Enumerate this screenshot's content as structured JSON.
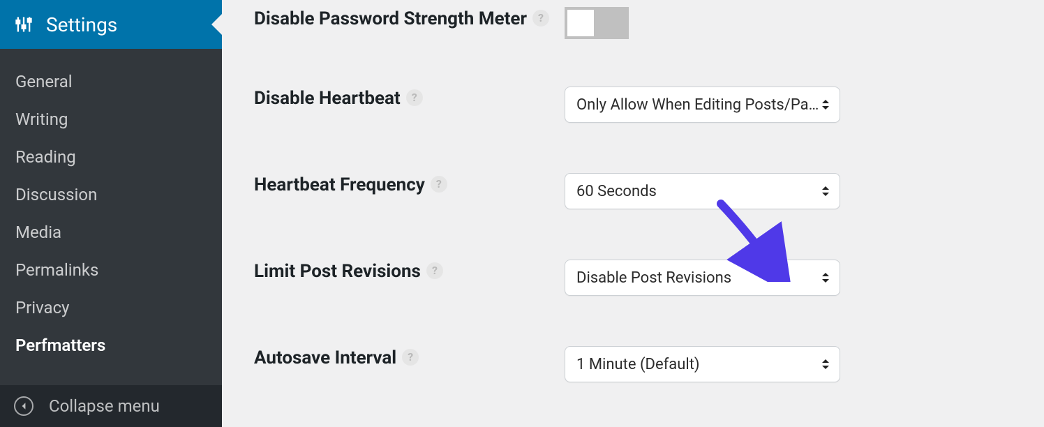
{
  "sidebar": {
    "parent_label": "Settings",
    "items": [
      {
        "label": "General"
      },
      {
        "label": "Writing"
      },
      {
        "label": "Reading"
      },
      {
        "label": "Discussion"
      },
      {
        "label": "Media"
      },
      {
        "label": "Permalinks"
      },
      {
        "label": "Privacy"
      },
      {
        "label": "Perfmatters"
      }
    ],
    "collapse_label": "Collapse menu"
  },
  "settings": {
    "disable_password_strength_meter": {
      "label": "Disable Password Strength Meter",
      "value": "off"
    },
    "disable_heartbeat": {
      "label": "Disable Heartbeat",
      "value": "Only Allow When Editing Posts/Pages"
    },
    "heartbeat_frequency": {
      "label": "Heartbeat Frequency",
      "value": "60 Seconds"
    },
    "limit_post_revisions": {
      "label": "Limit Post Revisions",
      "value": "Disable Post Revisions"
    },
    "autosave_interval": {
      "label": "Autosave Interval",
      "value": "1 Minute (Default)"
    }
  }
}
